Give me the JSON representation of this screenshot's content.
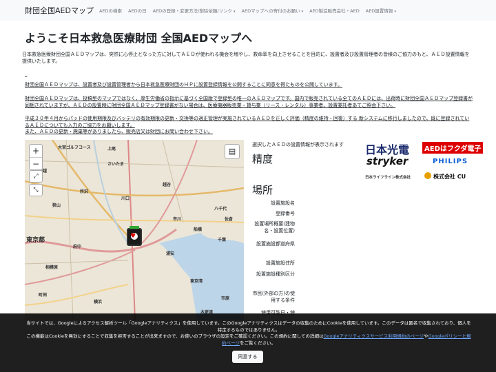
{
  "nav": {
    "brand": "財団全国AEDマップ",
    "items": [
      "AEDの検索",
      "AEDの日",
      "AEDの登録・変更方法/削除依頼/リンク",
      "AEDマップへの寄付のお願い",
      "AED製造販売会社・AED",
      "AED設置情報"
    ],
    "dropdown_caret": "▾"
  },
  "page": {
    "title": "ようこそ日本救急医療財団 全国AEDマップへ",
    "intro": "日本救急医療財団全国ＡＥＤマップは、突然に心停止となった方に対してＡＥＤが使われる機会を増やし、救命率を向上させることを目的に、設置者及び設置管理者の皆様のご協力のもと、ＡＥＤ設置情報を提供いたします。",
    "chevron": "⌄",
    "p1": "財団全国ＡＥＤマップは、設置者及び設置管理者から日本救急医療財団のＨＰに設置登録情報を公開することに同意を得たものを公開しています。",
    "p2a": "財団全国ＡＥＤマップは、投稿型のマップではなく、厚生労働省の指示に基づく全国版で登録型の唯一のＡＥＤマップです。",
    "p2b": "国内で販売されている全てのＡＥＤには、出荷時に財団全国ＡＥＤマップ登録書が同梱されていますが、ＡＥＤの設置時に財団全国ＡＥＤマップ登録書がない場合は、医療機器販売業・貸与業（リース・レンタル）事業者、設置委託者あてご照会下さい。",
    "p3a": "平成３０年４月からパッドの使用期限及びバッテリの有効期限の更新・交換等の適正管理が実施されているＡＥＤを正しく評価（精度の維持・回復）する 新システムに移行しましたので、既に登録されているＡＥＤについても入力のご協力をお願いします。",
    "p3b": "また、ＡＥＤの更新・廃棄等がありましたら、販売店又は財団にお問い合わせ下さい。"
  },
  "map": {
    "zoom_in": "+",
    "zoom_out": "−",
    "fullscreen_icon": "⤢",
    "locate_icon": "⤡",
    "layers_icon": "▤",
    "labels": [
      "大宮ゴルフコース",
      "川越",
      "入間",
      "さいたま",
      "上尾",
      "狭山",
      "所沢",
      "川口",
      "越谷",
      "東京都",
      "千葉",
      "市川",
      "船橋",
      "横浜",
      "町田",
      "浦安",
      "東京湾",
      "市原",
      "木更津",
      "八千代",
      "佐倉",
      "相模原",
      "府中"
    ]
  },
  "info": {
    "selected_text": "選択したＡＥＤの設置情報が表示されます",
    "accuracy_heading": "精度",
    "location_heading": "場所",
    "fields": [
      "設置施設名",
      "登録番号",
      "設置場所概要(建物名・設置位置)",
      "設置施設都道府県",
      "設置施設住所",
      "設置施設種別区分",
      "市民(外部の方)の使用する条件",
      "使用可能日・使"
    ]
  },
  "logos": {
    "nihon_kohden": "日本光電",
    "fukuda": "AEDはフクダ電子",
    "stryker": "stryker",
    "philips": "PHILIPS",
    "nihon_lifeline": "日本ライフライン株式会社",
    "cu": "株式会社 CU"
  },
  "cookie": {
    "text1": "当サイトでは、Googleによるアクセス解析ツール「Googleアナリティクス」を使用しています。このGoogleアナリティクスはデータの収集のためにCookieを使用しています。このデータは匿名で収集されており、個人を特定するものではありません。",
    "text2": "この機能はCookieを無効にすることで収集を拒否することが出来ますので、お使いのブラウザの設定をご確認ください。この規約に関しての詳細は",
    "link1": "Googleアナリティクスサービス利用規約のページ",
    "mid": "や",
    "link2": "Googleポリシーと規約ページ",
    "end": "をご覧ください。",
    "agree": "同意する"
  }
}
